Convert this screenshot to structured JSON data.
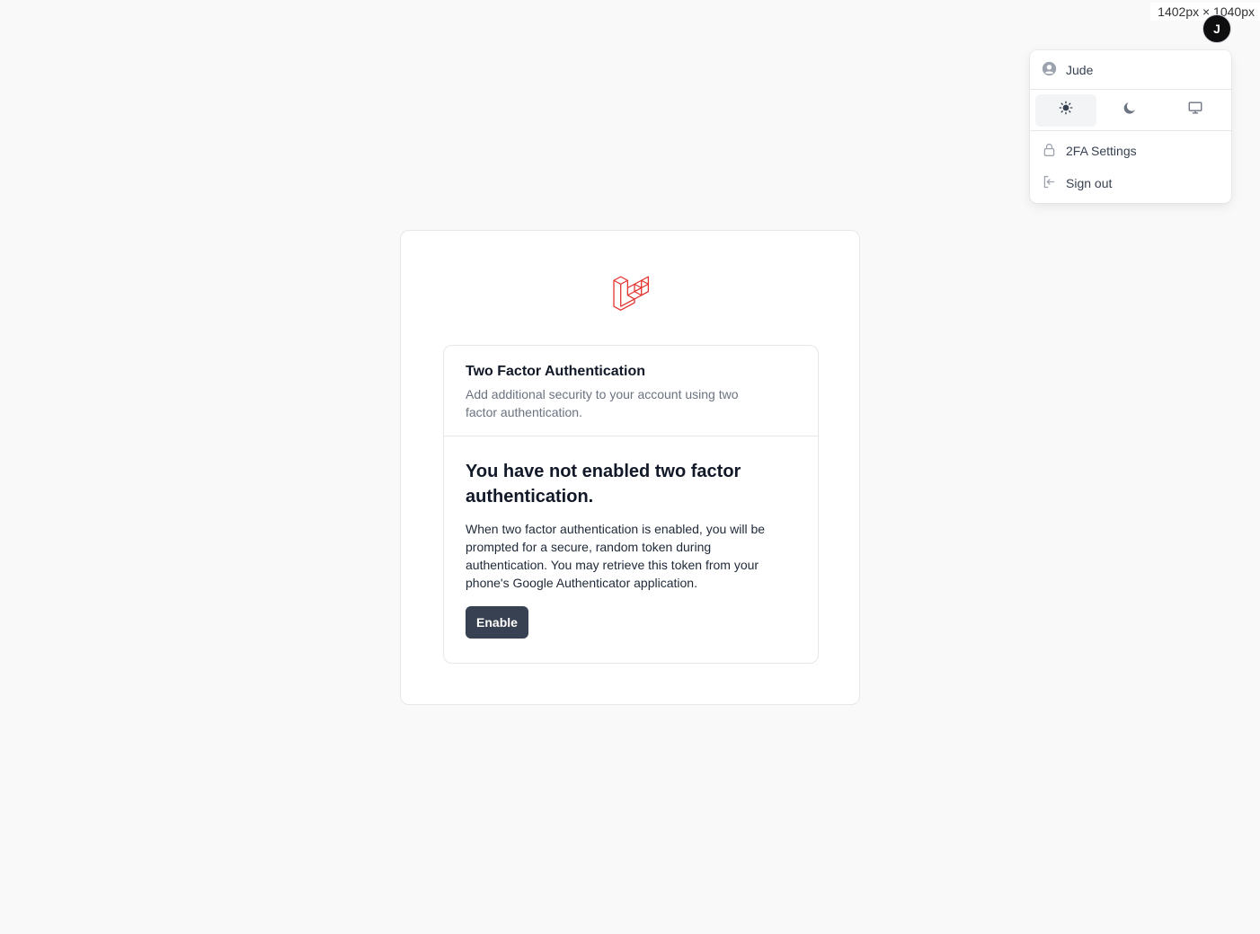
{
  "screenshot_label": "1402px × 1040px",
  "user": {
    "initial": "J",
    "name": "Jude"
  },
  "menu": {
    "theme_options": [
      {
        "icon": "sun-icon",
        "name": "light",
        "active": true
      },
      {
        "icon": "moon-icon",
        "name": "dark",
        "active": false
      },
      {
        "icon": "monitor-icon",
        "name": "system",
        "active": false
      }
    ],
    "items": [
      {
        "label": "2FA Settings",
        "icon": "lock-icon"
      },
      {
        "label": "Sign out",
        "icon": "sign-out-icon"
      }
    ]
  },
  "logo": {
    "icon": "laravel-logo",
    "color": "#e3342f"
  },
  "two_factor": {
    "title": "Two Factor Authentication",
    "subtitle": "Add additional security to your account using two factor authentication.",
    "status_heading": "You have not enabled two factor authentication.",
    "description": "When two factor authentication is enabled, you will be prompted for a secure, random token during authentication. You may retrieve this token from your phone's Google Authenticator application.",
    "enable_label": "Enable"
  },
  "colors": {
    "background": "#f9f9f9",
    "button": "#374151",
    "avatar": "#0f0f0f",
    "brand": "#e3342f"
  }
}
